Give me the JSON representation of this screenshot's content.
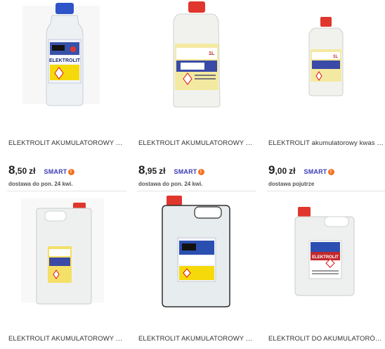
{
  "products": [
    {
      "title": "ELEKTROLIT AKUMULATOROWY KWA...",
      "price_int": "8",
      "price_dec": ",50",
      "currency": "zł",
      "badge": "SMART",
      "delivery": "dostawa do pon. 24 kwi."
    },
    {
      "title": "ELEKTROLIT AKUMULATOROWY KWA...",
      "price_int": "8",
      "price_dec": ",95",
      "currency": "zł",
      "badge": "SMART",
      "delivery": "dostawa do pon. 24 kwi."
    },
    {
      "title": "ELEKTROLIT akumulatorowy kwas do ...",
      "price_int": "9",
      "price_dec": ",00",
      "currency": "zł",
      "badge": "SMART",
      "delivery": "dostawa pojutrze"
    },
    {
      "title": "ELEKTROLIT AKUMULATOROWY KWA..."
    },
    {
      "title": "ELEKTROLIT AKUMULATOROWY KWA..."
    },
    {
      "title": "ELEKTROLIT DO AKUMULATORÓW IM..."
    }
  ],
  "bottle_labels": {
    "small_volume": "1L",
    "brand_text": "ELEKTROLIT"
  },
  "colors": {
    "price": "#222222",
    "smart_badge": "#3b3bb3",
    "smart_bolt": "#f37021",
    "cap_blue": "#2d55c8",
    "cap_red": "#e0362d"
  }
}
